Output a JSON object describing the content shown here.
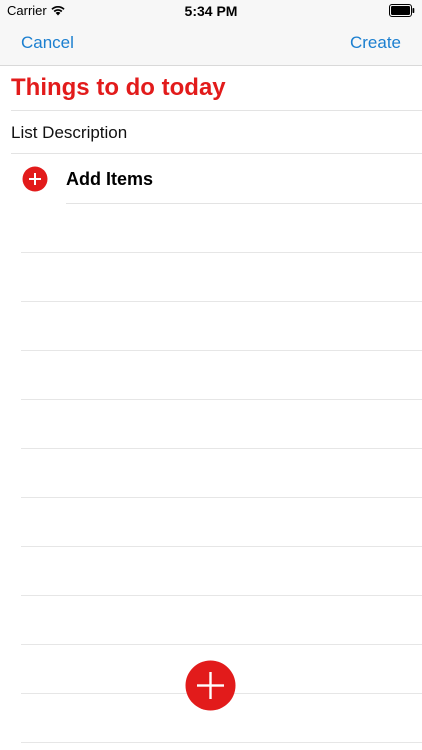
{
  "status_bar": {
    "carrier": "Carrier",
    "time": "5:34 PM",
    "icons": [
      "wifi-icon",
      "battery-icon"
    ]
  },
  "nav": {
    "cancel_label": "Cancel",
    "create_label": "Create"
  },
  "list": {
    "title": "Things to do today",
    "description_placeholder": "List Description",
    "add_items_label": "Add Items"
  },
  "colors": {
    "accent_red": "#e21b1b",
    "link_blue": "#1b7fd0"
  }
}
